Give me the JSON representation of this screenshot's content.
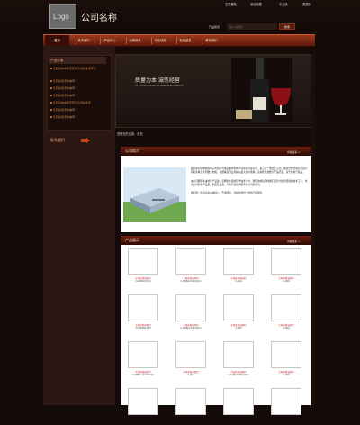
{
  "header": {
    "logo_text": "Logo",
    "company_name": "公司名称",
    "top_links": [
      "会员登陆",
      "添加收藏",
      "中文版",
      "英语版"
    ],
    "search_label": "产品搜索",
    "search_placeholder": "输入关键字",
    "search_button": "搜索"
  },
  "nav": {
    "items": [
      "首页",
      "关于我们",
      "产品中心",
      "新闻资讯",
      "行业动态",
      "在线留言",
      "联系我们"
    ]
  },
  "sidebar": {
    "category_title": "产品分类",
    "categories": [
      "大同彩条电带手环打大同彩条手环打",
      "大同彩条手机电带",
      "大同彩条手机电带",
      "大同彩条手机电带",
      "大同彩条电带手环打大同彩条手",
      "大同彩条手机电带",
      "大同彩条手机电带"
    ],
    "contact_title": "联系我们"
  },
  "banner": {
    "title": "质量为本  诚信经营",
    "subtitle": "TO LIVE BY QUALITY,TO DEVELOP BY PRESTIGE"
  },
  "breadcrumb": "您现在的位置：首页",
  "company_intro": {
    "title": "公司简介",
    "more": "查看更多 >",
    "text": [
      "我是常州康维智能电子有限公司成功委托机构大自动化开发公司，第三方一站式工公司，通过分化并成功打造大同彩条联合大同数字智能，完整覆盖行业领域以最大用户需求，该地区大型数字产品开发，对于各地产品业。",
      "本公司拥有先进的生产设备，还拥有大量的科学技术人才，我们的成功同时我们还有大批有经验的技术工人，也有公司的生产设备，配备及设备，与用户满意为服务为公司的宗旨。",
      "我们的一贯宗旨是以诚待人，严谨经营，为社会提供一流的产品服务。"
    ]
  },
  "products": {
    "title": "产品展示",
    "more": "查看更多 >",
    "items": [
      {
        "name": "大同彩条电带打",
        "code": "(1-2004.5mm)"
      },
      {
        "name": "大同彩条电带打",
        "code": "C-1/46(2-3044)mm"
      },
      {
        "name": "大同彩条电带打",
        "code": "C-414"
      },
      {
        "name": "大同彩条电带打",
        "code": "C-400"
      },
      {
        "name": "大同彩条电带打",
        "code": "A1-1544b-154"
      },
      {
        "name": "大同彩条电带打",
        "code": "C-1/46(2-3044)mm"
      },
      {
        "name": "大同彩条电带打",
        "code": "C-405"
      },
      {
        "name": "大同彩条电带打",
        "code": "C-400"
      },
      {
        "name": "大同彩条电带打",
        "code": "C-2085(1-20/22mm)"
      },
      {
        "name": "大同彩条电带打",
        "code": "C-403"
      },
      {
        "name": "大同彩条电带打",
        "code": "C-1/46(2-3044)mm"
      },
      {
        "name": "大同彩条电带打",
        "code": "C-400"
      },
      {
        "name": "",
        "code": ""
      },
      {
        "name": "",
        "code": ""
      },
      {
        "name": "",
        "code": ""
      },
      {
        "name": "",
        "code": ""
      }
    ]
  }
}
